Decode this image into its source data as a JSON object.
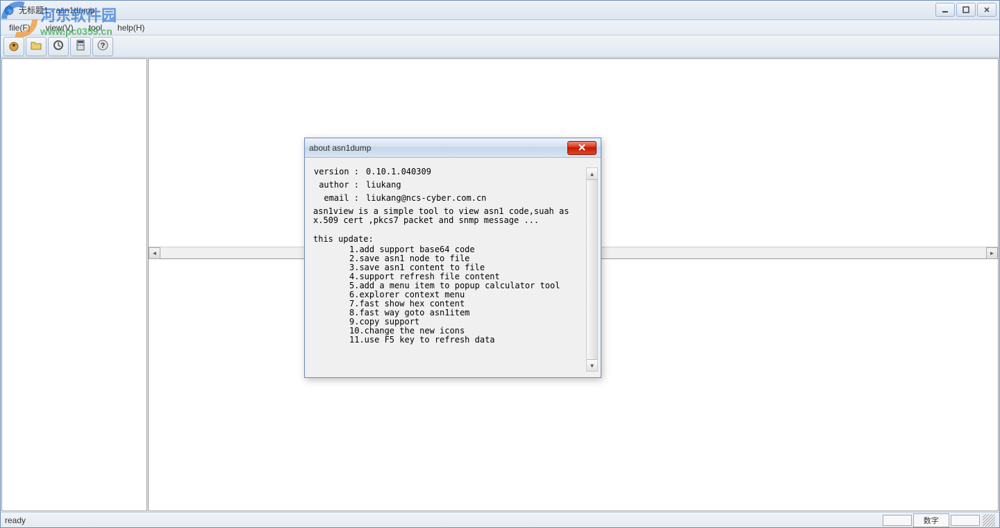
{
  "window": {
    "title": "无标题1 - asn1dump"
  },
  "menu": {
    "file": "file(F)",
    "view": "view(V)",
    "tool": "tool",
    "help": "help(H)"
  },
  "dialog": {
    "title": "about asn1dump",
    "version_label": "version :",
    "version_value": "0.10.1.040309",
    "author_label": "author :",
    "author_value": "liukang",
    "email_label": "email :",
    "email_value": "liukang@ncs-cyber.com.cn",
    "description": "asn1view is a simple tool to view asn1 code,suah as\nx.509 cert ,pkcs7 packet and snmp message ...",
    "update_title": "this update:",
    "updates": {
      "u1": "1.add support base64 code",
      "u2": "2.save asn1 node to file",
      "u3": "3.save asn1 content to file",
      "u4": "4.support refresh file content",
      "u5": "5.add a menu item to popup calculator tool",
      "u6": "6.explorer context menu",
      "u7": "7.fast show hex content",
      "u8": "8.fast way goto asn1item",
      "u9": "9.copy support",
      "u10": "10.change the new icons",
      "u11": "11.use F5 key to refresh data"
    }
  },
  "status": {
    "ready": "ready",
    "right": "数字"
  },
  "watermark": {
    "text": "河东软件园",
    "url": "www.pc0359.cn"
  }
}
